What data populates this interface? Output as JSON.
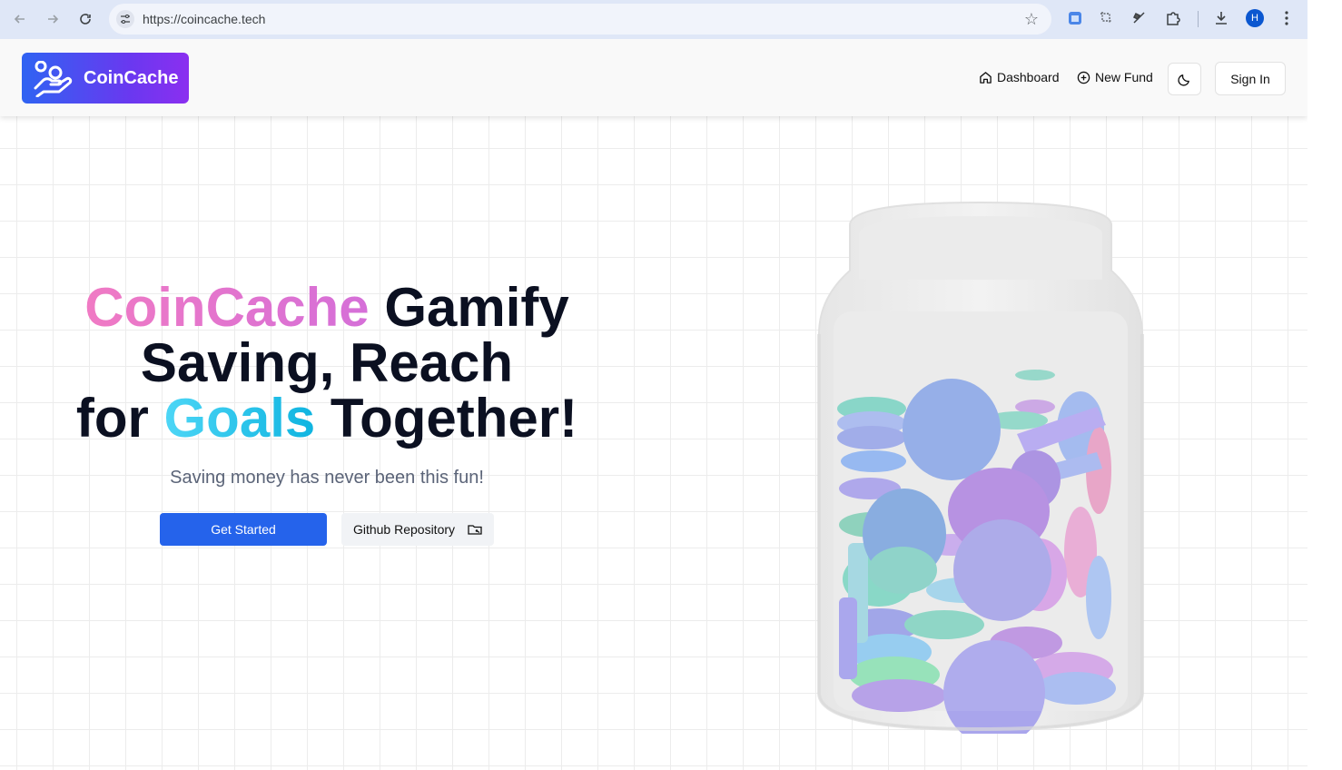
{
  "browser": {
    "url": "https://coincache.tech",
    "profile_initial": "H"
  },
  "header": {
    "logo_text": "CoinCache",
    "nav": {
      "dashboard": "Dashboard",
      "new_fund": "New Fund"
    },
    "sign_in": "Sign In"
  },
  "hero": {
    "title_part1": "CoinCache",
    "title_part2": " Gamify",
    "title_line2": "Saving, Reach",
    "title_line3_pre": "for ",
    "title_line3_accent": "Goals",
    "title_line3_post": " Together!",
    "subtitle": "Saving money has never been this fun!",
    "get_started": "Get Started",
    "github": "Github Repository"
  },
  "colors": {
    "primary": "#2563eb",
    "logo_gradient_start": "#2f63f2",
    "logo_gradient_end": "#8b2ff0",
    "title_pink": "#e27ad0",
    "title_cyan": "#1fbbe6",
    "title_dark": "#0b1021"
  },
  "icons": {
    "dashboard": "home-icon",
    "new_fund": "plus-circle-icon",
    "theme": "moon-icon",
    "github": "folder-git-icon"
  }
}
